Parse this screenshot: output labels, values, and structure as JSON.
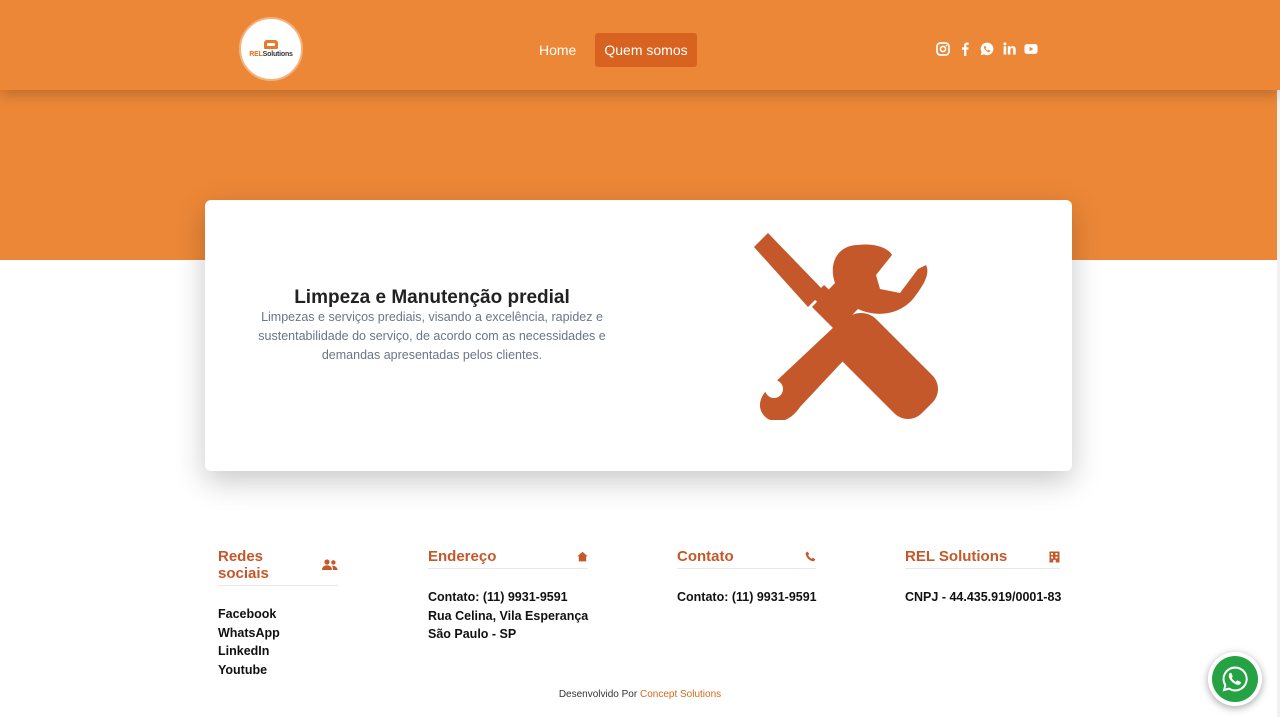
{
  "header": {
    "logo": {
      "text_rel": "REL",
      "text_solutions": "Solutions"
    },
    "nav": [
      {
        "label": "Home"
      },
      {
        "label": "Quem somos"
      }
    ],
    "social_icons": [
      "instagram-icon",
      "facebook-icon",
      "whatsapp-icon",
      "linkedin-icon",
      "youtube-icon"
    ]
  },
  "card": {
    "title": "Limpeza e Manutenção predial",
    "description": "Limpezas e serviços prediais, visando a excelência, rapidez e sustentabilidade do serviço, de acordo com as necessidades e demandas apresentadas pelos clientes.",
    "illustration": "tools-icon"
  },
  "footer": {
    "columns": [
      {
        "title": "Redes sociais",
        "icon": "users-icon",
        "items": [
          "Facebook",
          "WhatsApp",
          "LinkedIn",
          "Youtube"
        ]
      },
      {
        "title": "Endereço",
        "icon": "home-icon",
        "items": [
          "Contato: (11) 9931-9591",
          "Rua Celina, Vila Esperança",
          "São Paulo - SP"
        ]
      },
      {
        "title": "Contato",
        "icon": "phone-icon",
        "items": [
          "Contato: (11) 9931-9591"
        ]
      },
      {
        "title": "REL Solutions",
        "icon": "building-icon",
        "items": [
          "CNPJ - 44.435.919/0001-83"
        ]
      }
    ],
    "credit_prefix": "Desenvolvido Por",
    "credit_brand": "Concept Solutions"
  },
  "colors": {
    "primary": "#ec8737",
    "accent": "#c4582a",
    "nav_active": "#d8621f",
    "whatsapp": "#25a244"
  }
}
